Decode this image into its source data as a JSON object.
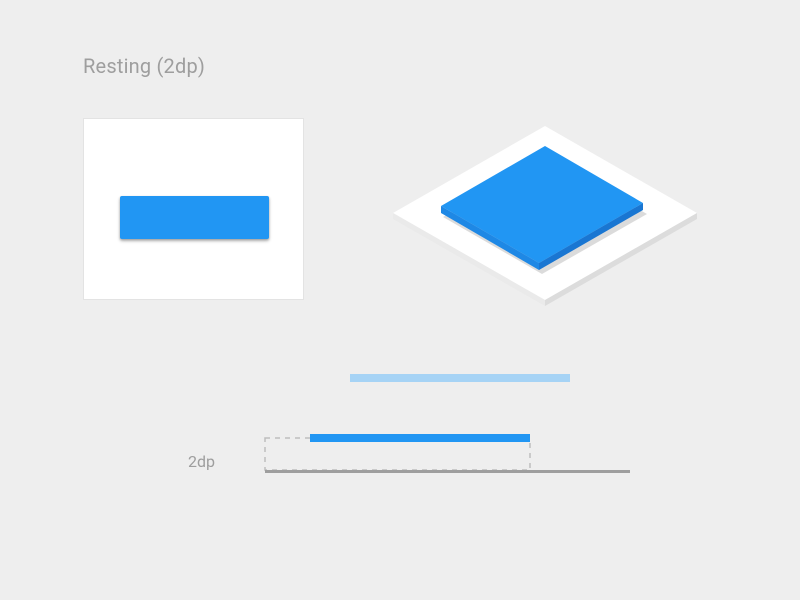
{
  "title": "Resting (2dp)",
  "elevation_label": "2dp",
  "colors": {
    "primary": "#2196F3",
    "primary_light": "#A6D3F5",
    "primary_edge": "#1A78C2",
    "surface": "#FFFFFF",
    "surface_edge": "#EAEAEA",
    "background": "#EEEEEE",
    "outline": "#BDBDBD",
    "baseline": "#9E9E9E",
    "text_muted": "#9E9E9E"
  },
  "diagram": {
    "elevation_dp": 2,
    "component": "raised-button",
    "views": [
      "front",
      "isometric",
      "side"
    ]
  }
}
